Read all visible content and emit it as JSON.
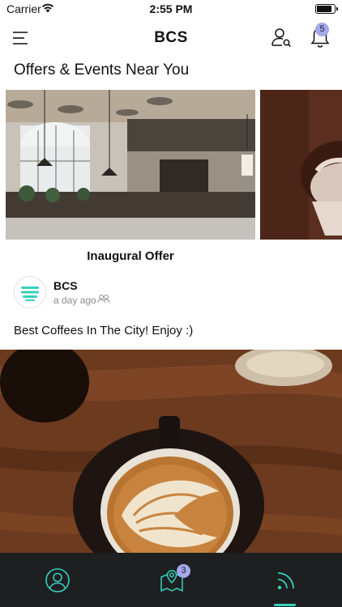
{
  "status_bar": {
    "carrier": "Carrier",
    "time": "2:55 PM",
    "battery_level": 0.92
  },
  "nav_bar": {
    "title": "BCS",
    "notification_count": "5",
    "icons": [
      "menu-icon",
      "profile-search-icon",
      "bell-icon"
    ]
  },
  "section": {
    "title": "Offers & Events Near You"
  },
  "carousel": {
    "cards": [
      {
        "title": "Inaugural Offer",
        "image": "cafe-interior-photo"
      },
      {
        "title": "",
        "image": "coffee-cup-photo"
      }
    ]
  },
  "post": {
    "author": "BCS",
    "timestamp": "a day ago",
    "audience_icon": "group-icon",
    "text": "Best Coffees In The City! Enjoy :)",
    "image": "latte-art-photo"
  },
  "tab_bar": {
    "tabs": [
      {
        "name": "profile",
        "icon": "user-circle-icon",
        "badge": ""
      },
      {
        "name": "map",
        "icon": "map-pin-icon",
        "badge": "3"
      },
      {
        "name": "feed",
        "icon": "rss-feed-icon",
        "badge": "",
        "active": true
      }
    ],
    "active_color": "#35d0bd",
    "background": "#1d1f21"
  },
  "colors": {
    "accent": "#35d0bd",
    "badge": "#a5a8e8"
  }
}
